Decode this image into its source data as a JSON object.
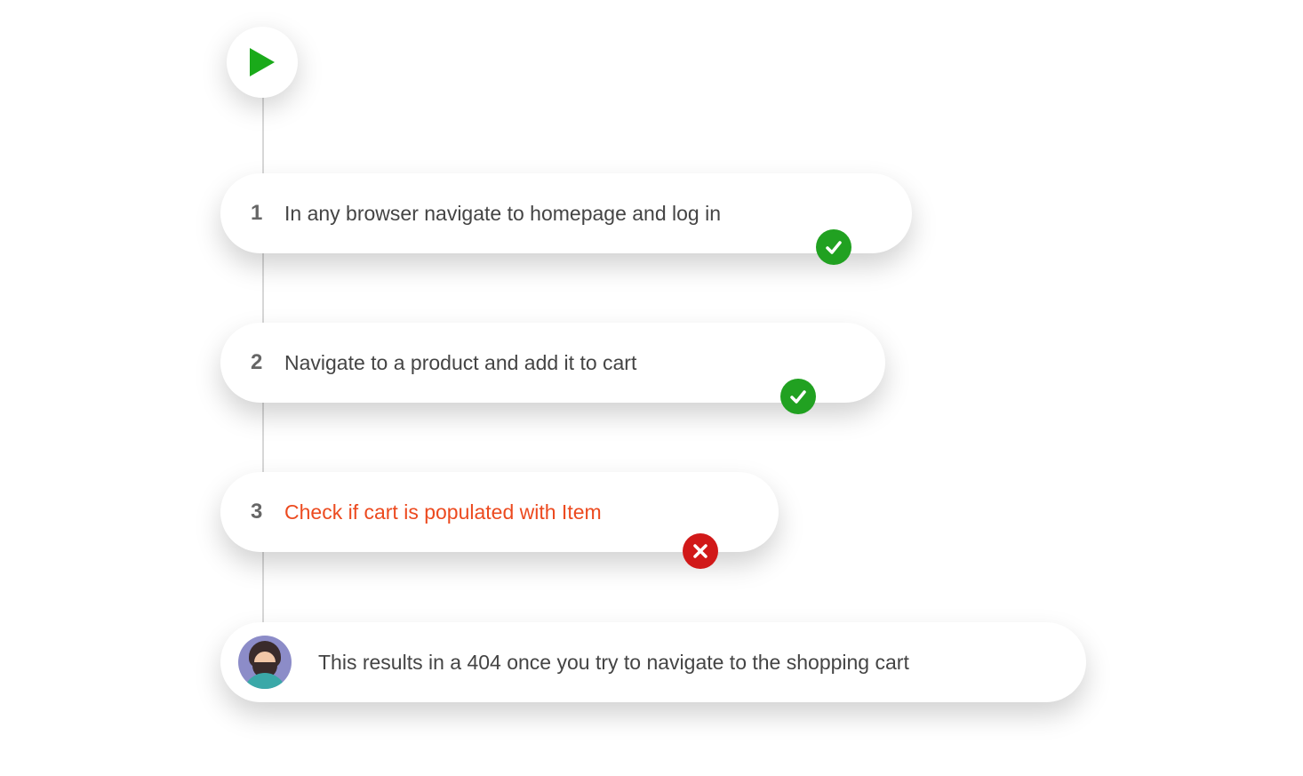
{
  "icons": {
    "play": "play-icon",
    "check": "check-icon",
    "x": "x-icon",
    "avatar": "person-avatar-icon"
  },
  "colors": {
    "success": "#21a121",
    "error_badge": "#d11919",
    "error_text": "#ec4a1f",
    "text": "#444444",
    "number": "#666666"
  },
  "steps": [
    {
      "number": "1",
      "text": "In any browser navigate to homepage and log in",
      "status": "pass"
    },
    {
      "number": "2",
      "text": "Navigate to a product and add it to cart",
      "status": "pass"
    },
    {
      "number": "3",
      "text": "Check if cart is populated with Item",
      "status": "fail"
    }
  ],
  "comment": {
    "text": "This results in a 404 once you try to navigate to the shopping cart"
  }
}
